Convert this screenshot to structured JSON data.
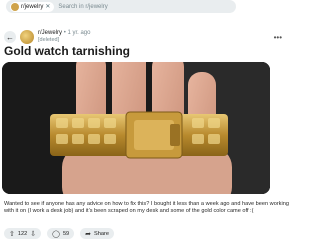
{
  "search": {
    "chip_label": "r/jewelry",
    "placeholder": "Search in r/jewelry"
  },
  "post": {
    "subreddit": "r/Jewelry",
    "age": "1 yr. ago",
    "author": "[deleted]",
    "title": "Gold watch tarnishing",
    "body": "Wanted to see if anyone has any advice on how to fix this? I bought it less than a week ago and have been working with it on (I work a desk job) and it’s been scraped on my desk and some of the gold color came off :(",
    "votes": "122",
    "comments": "59",
    "share_label": "Share"
  },
  "icons": {
    "back": "arrow-left-icon",
    "upvote": "upvote-icon",
    "downvote": "downvote-icon",
    "comment": "comment-icon",
    "share": "share-icon",
    "more": "more-icon"
  }
}
